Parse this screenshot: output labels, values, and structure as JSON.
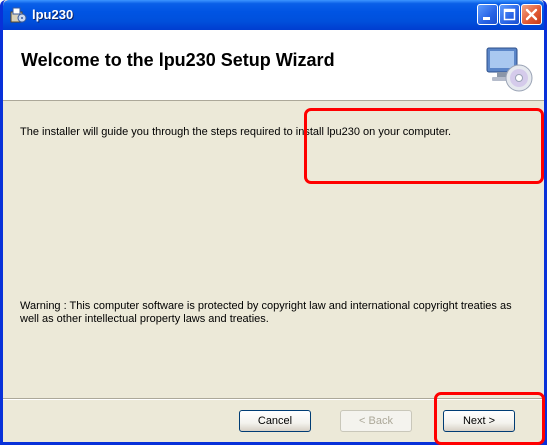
{
  "window": {
    "title": "lpu230",
    "icon": "installer-package-icon"
  },
  "titlebar_buttons": {
    "minimize_icon": "minimize-icon",
    "maximize_icon": "maximize-icon",
    "close_icon": "close-icon"
  },
  "header": {
    "title": "Welcome to the lpu230 Setup Wizard",
    "graphic_icon": "computer-cd-setup-icon"
  },
  "body": {
    "intro": "The installer will guide you through the steps required to install lpu230 on your computer.",
    "warning": "Warning : This computer software is protected by copyright law and international copyright treaties as well as other intellectual property laws and treaties."
  },
  "buttons": {
    "cancel": "Cancel",
    "back": "< Back",
    "next": "Next >"
  },
  "highlights": {
    "color": "#ff0000"
  }
}
